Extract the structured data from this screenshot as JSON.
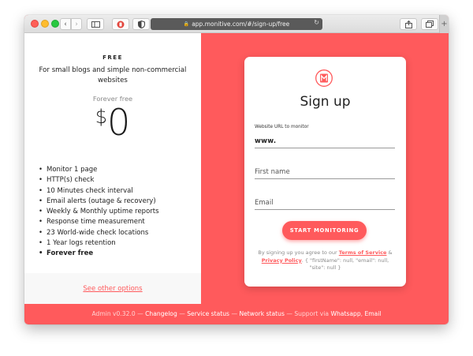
{
  "browser": {
    "url": "app.monitive.com/#/sign-up/free",
    "plus_label": "+"
  },
  "plan": {
    "name": "FREE",
    "description": "For small blogs and simple non-commercial websites",
    "price_label": "Forever free",
    "currency": "$",
    "amount": "0",
    "features": [
      "Monitor 1 page",
      "HTTP(s) check",
      "10 Minutes check interval",
      "Email alerts (outage & recovery)",
      "Weekly & Monthly uptime reports",
      "Response time measurement",
      "23 World-wide check locations",
      "1 Year logs retention",
      "Forever free"
    ],
    "see_other_label": "See other options"
  },
  "signup": {
    "title": "Sign up",
    "website_label": "Website URL to monitor",
    "website_value": "www.",
    "first_name_placeholder": "First name",
    "email_placeholder": "Email",
    "submit_label": "START MONITORING",
    "terms_prefix": "By signing up you agree to our ",
    "terms_link": "Terms of Service",
    "terms_and": " & ",
    "privacy_link": "Privacy Policy",
    "terms_suffix": ". { \"firstName\": null, \"email\": null, \"site\": null }"
  },
  "footer": {
    "admin": "Admin v0.32.0",
    "sep": " — ",
    "changelog": "Changelog",
    "service_status": "Service status",
    "network_status": "Network status",
    "support_via": "Support via ",
    "whatsapp": "Whatsapp",
    "email": "Email"
  },
  "colors": {
    "brand": "#ff5a5c"
  }
}
